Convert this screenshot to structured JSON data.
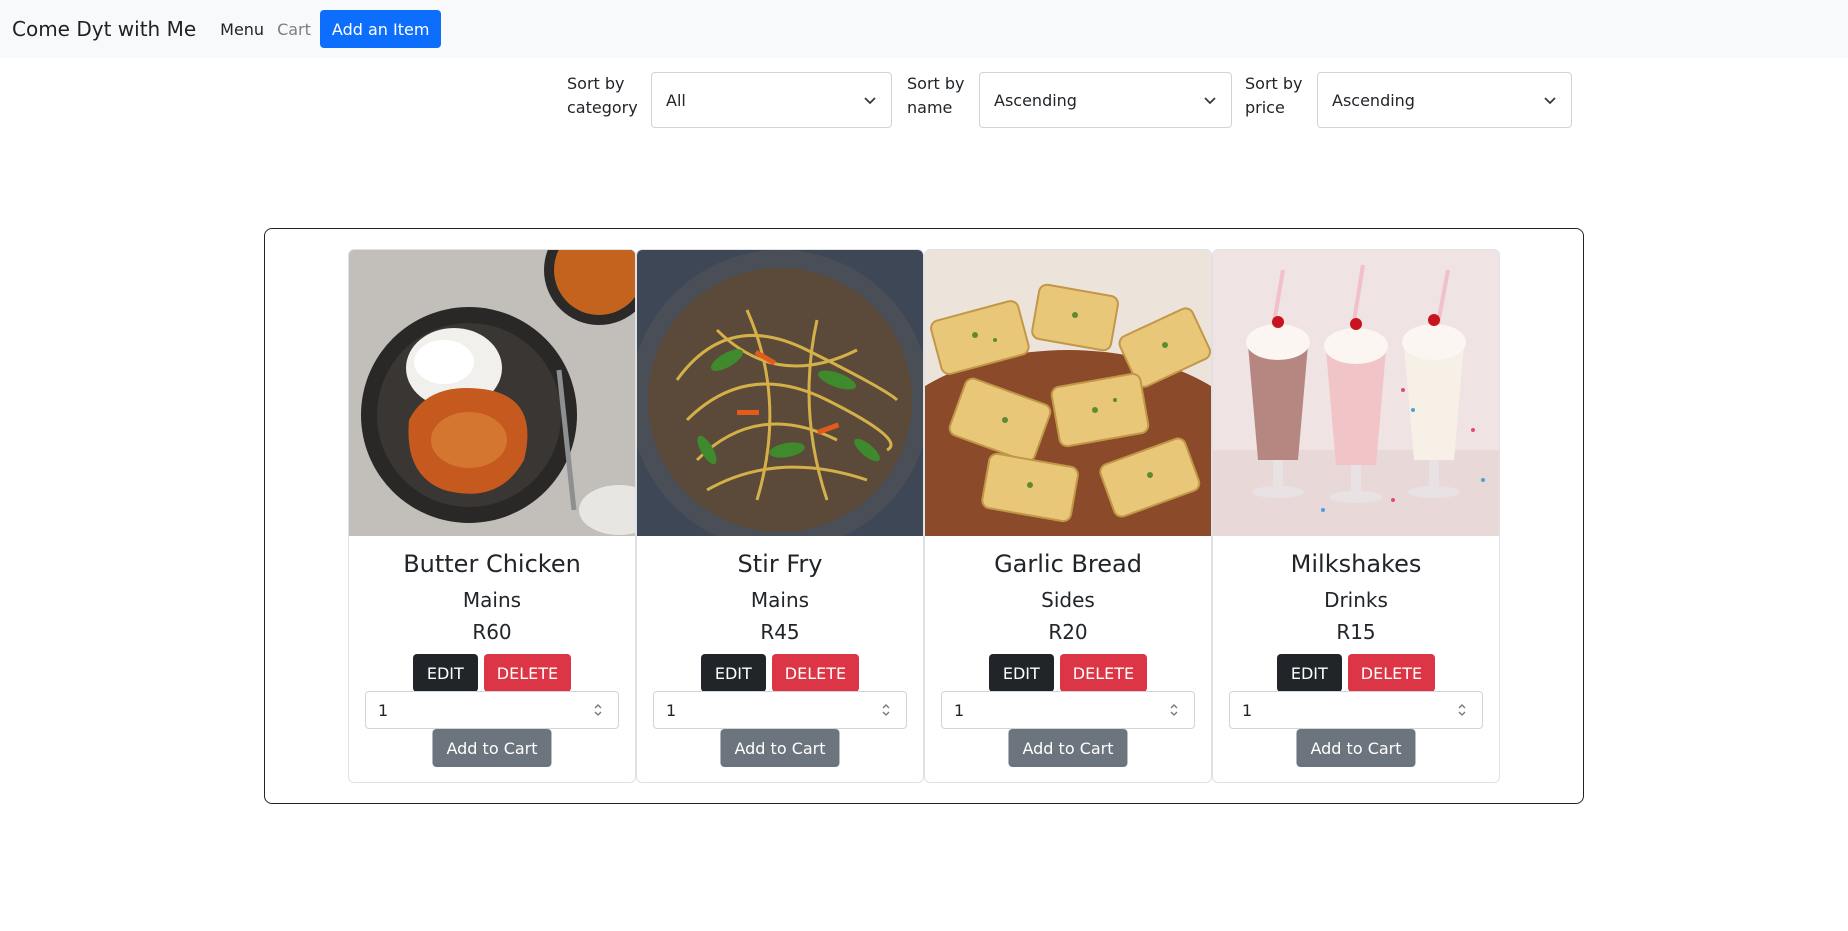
{
  "navbar": {
    "brand": "Come Dyt with Me",
    "menu_label": "Menu",
    "cart_label": "Cart",
    "add_item_label": "Add an Item"
  },
  "sort": {
    "category_label": "Sort by category",
    "category_value": "All",
    "name_label": "Sort by name",
    "name_value": "Ascending",
    "price_label": "Sort by price",
    "price_value": "Ascending"
  },
  "items": [
    {
      "name": "Butter Chicken",
      "category": "Mains",
      "price": "R60",
      "quantity": "1",
      "image": "butter-chicken-image"
    },
    {
      "name": "Stir Fry",
      "category": "Mains",
      "price": "R45",
      "quantity": "1",
      "image": "stir-fry-image"
    },
    {
      "name": "Garlic Bread",
      "category": "Sides",
      "price": "R20",
      "quantity": "1",
      "image": "garlic-bread-image"
    },
    {
      "name": "Milkshakes",
      "category": "Drinks",
      "price": "R15",
      "quantity": "1",
      "image": "milkshakes-image"
    }
  ],
  "buttons": {
    "edit": "EDIT",
    "delete": "DELETE",
    "add_to_cart": "Add to Cart"
  },
  "colors": {
    "primary": "#0d6efd",
    "danger": "#dc3545",
    "dark": "#212529",
    "secondary": "#6c757d",
    "navbar_bg": "#f8f9fa"
  }
}
